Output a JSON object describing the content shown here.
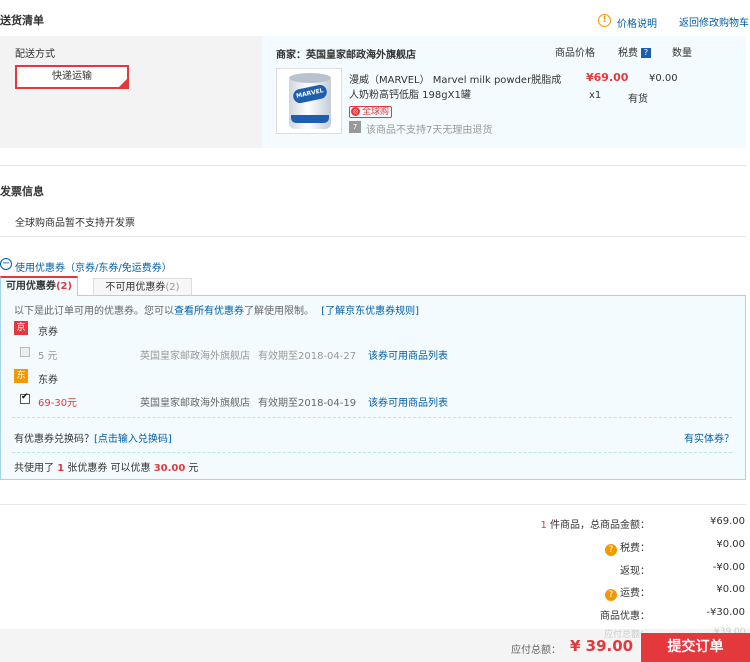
{
  "delivery": {
    "title": "送货清单",
    "price_note": "价格说明",
    "back_to_cart": "返回修改购物车",
    "shipping_method_label": "配送方式",
    "shipping_method_value": "快递运输",
    "merchant": "商家：英国皇家邮政海外旗舰店",
    "col_price": "商品价格",
    "col_tax": "税费",
    "col_qty": "数量",
    "product": {
      "name_line1": "漫威（MARVEL） Marvel milk powder脱脂成",
      "name_line2": "人奶粉高钙低脂 198gX1罐",
      "price": "¥69.00",
      "tax": "¥0.00",
      "qty": "x1",
      "stock": "有货",
      "global_tag": "全球购",
      "return_note": "该商品不支持7天无理由退货",
      "can_logo": "MARVEL"
    }
  },
  "invoice": {
    "title": "发票信息",
    "note": "全球购商品暂不支持开发票"
  },
  "coupons": {
    "toggle_label": "使用优惠券（京券/东券/免运费券）",
    "tab_available": "可用优惠券",
    "tab_available_count": "(2)",
    "tab_unavailable": "不可用优惠券",
    "tab_unavailable_count": "(2)",
    "intro_prefix": "以下是此订单可用的优惠券。您可以",
    "intro_link": "查看所有优惠券",
    "intro_suffix": "了解使用限制。",
    "rules_link": "[了解京东优惠券规则]",
    "groups": [
      {
        "badge": "京",
        "name": "京券",
        "item": {
          "value": "5 元",
          "shop": "英国皇家邮政海外旗舰店",
          "expiry": "有效期至2018-04-27",
          "link": "该券可用商品列表",
          "checked": false
        }
      },
      {
        "badge": "东",
        "name": "东券",
        "item": {
          "value": "69-30元",
          "shop": "英国皇家邮政海外旗舰店",
          "expiry": "有效期至2018-04-19",
          "link": "该券可用商品列表",
          "checked": true
        }
      }
    ],
    "redeem_prefix": "有优惠券兑换码？",
    "redeem_link": "[点击输入兑换码]",
    "physical_coupon": "有实体券？",
    "summary_used_prefix": "共使用了",
    "summary_used_count": "1",
    "summary_used_mid": "张优惠券   可以优惠",
    "summary_discount": "30.00",
    "summary_unit": "元"
  },
  "summary": {
    "count": "1",
    "count_label": "件商品，总商品金额：",
    "total_goods": "¥69.00",
    "tax_label": "税费：",
    "tax": "¥0.00",
    "cashback_label": "返现：",
    "cashback": "-¥0.00",
    "freight_label": "运费：",
    "freight": "¥0.00",
    "discount_label": "商品优惠：",
    "discount": "-¥30.00",
    "payable_label": "应付总额：",
    "payable": "¥ 39.00",
    "submit": "提交订单",
    "ghost_label": "应付总额：",
    "ghost_value": "¥39.00"
  },
  "colors": {
    "accent_red": "#e4393c",
    "link_blue": "#005ea7",
    "orange": "#f39800",
    "panel_blue": "#f3fbfe"
  }
}
